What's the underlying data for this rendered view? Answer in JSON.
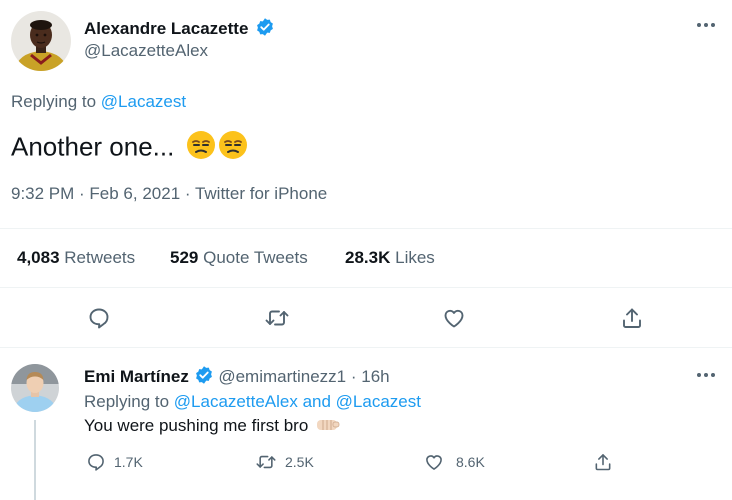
{
  "main_tweet": {
    "author_name": "Alexandre Lacazette",
    "author_handle": "@LacazetteAlex",
    "replying_label": "Replying to",
    "replying_to": "@Lacazest",
    "text": "Another one...",
    "text_emojis": [
      "unamused-face",
      "unamused-face"
    ],
    "timestamp": "9:32 PM · Feb 6, 2021 · Twitter for iPhone",
    "stats": {
      "retweets_count": "4,083",
      "retweets_label": "Retweets",
      "quote_count": "529",
      "quote_label": "Quote Tweets",
      "likes_count": "28.3K",
      "likes_label": "Likes"
    }
  },
  "reply_tweet": {
    "author_name": "Emi Martínez",
    "author_handle": "@emimartinezz1",
    "separator": "·",
    "time": "16h",
    "replying_label": "Replying to",
    "replying_to": "@LacazetteAlex and @Lacazest",
    "text": "You were pushing me first bro",
    "text_emoji": "raised-fist",
    "reply_count": "1.7K",
    "retweet_count": "2.5K",
    "like_count": "8.6K"
  },
  "colors": {
    "accent": "#1d9bf0",
    "text": "#0f1419",
    "secondary": "#536471",
    "divider": "#eff3f4"
  }
}
